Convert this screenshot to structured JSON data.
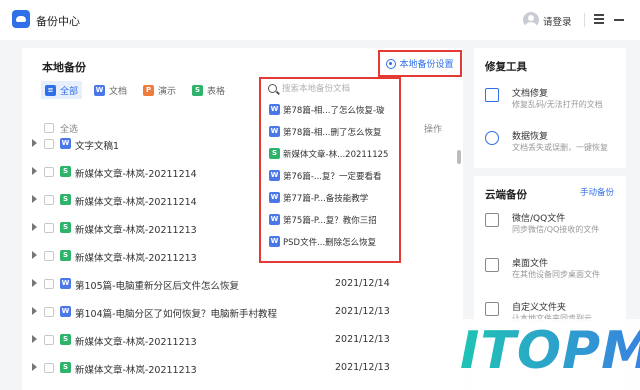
{
  "app": {
    "title": "备份中心",
    "login_label": "请登录"
  },
  "local_backup": {
    "title": "本地备份",
    "settings_label": "本地备份设置",
    "filters": [
      {
        "label": "全部",
        "color": "#2f6fe8",
        "letter": "≡"
      },
      {
        "label": "文档",
        "color": "#4a78e8",
        "letter": "W"
      },
      {
        "label": "演示",
        "color": "#ef7b3c",
        "letter": "P"
      },
      {
        "label": "表格",
        "color": "#2eb36b",
        "letter": "S"
      }
    ],
    "header": {
      "select_all": "全选",
      "operation": "操作"
    },
    "rows": [
      {
        "name": "文字文稿1",
        "date": "",
        "type": "doc"
      },
      {
        "name": "新媒体文章-林岚-20211214",
        "date": "",
        "type": "xls"
      },
      {
        "name": "新媒体文章-林岚-20211214",
        "date": "",
        "type": "xls"
      },
      {
        "name": "新媒体文章-林岚-20211213",
        "date": "",
        "type": "xls"
      },
      {
        "name": "新媒体文章-林岚-20211213",
        "date": "",
        "type": "xls"
      },
      {
        "name": "第105篇-电脑重新分区后文件怎么恢复",
        "date": "2021/12/14",
        "type": "doc"
      },
      {
        "name": "第104篇-电脑分区了如何恢复？电脑新手村教程",
        "date": "2021/12/13",
        "type": "doc"
      },
      {
        "name": "新媒体文章-林岚-20211213",
        "date": "2021/12/13",
        "type": "xls"
      },
      {
        "name": "新媒体文章-林岚-20211213",
        "date": "2021/12/13",
        "type": "xls"
      }
    ]
  },
  "search": {
    "placeholder": "搜索本地备份文档",
    "results": [
      {
        "text": "第78篇-相...了怎么恢复-璇",
        "type": "doc"
      },
      {
        "text": "第78篇-相...删了怎么恢复",
        "type": "doc"
      },
      {
        "text": "新媒体文章-林...20211125",
        "type": "xls"
      },
      {
        "text": "第76篇-...复？一定要看看",
        "type": "doc"
      },
      {
        "text": "第77篇-P...备技能教学",
        "type": "doc"
      },
      {
        "text": "第75篇-P...复？教你三招",
        "type": "doc"
      },
      {
        "text": "PSD文件...删除怎么恢复",
        "type": "doc"
      }
    ]
  },
  "repair_tools": {
    "title": "修复工具",
    "items": [
      {
        "label": "文档修复",
        "sub": "修复乱码/无法打开的文档"
      },
      {
        "label": "数据恢复",
        "sub": "文档丢失或误删，一键恢复"
      }
    ]
  },
  "cloud_backup": {
    "title": "云端备份",
    "manual_label": "手动备份",
    "items": [
      {
        "label": "微信/QQ文件",
        "sub": "同步微信/QQ接收的文件"
      },
      {
        "label": "桌面文件",
        "sub": "在其他设备同步桌面文件"
      },
      {
        "label": "自定义文件夹",
        "sub": "让本地文件夹同步到云"
      }
    ]
  },
  "watermark": {
    "text": "ITOPM"
  }
}
